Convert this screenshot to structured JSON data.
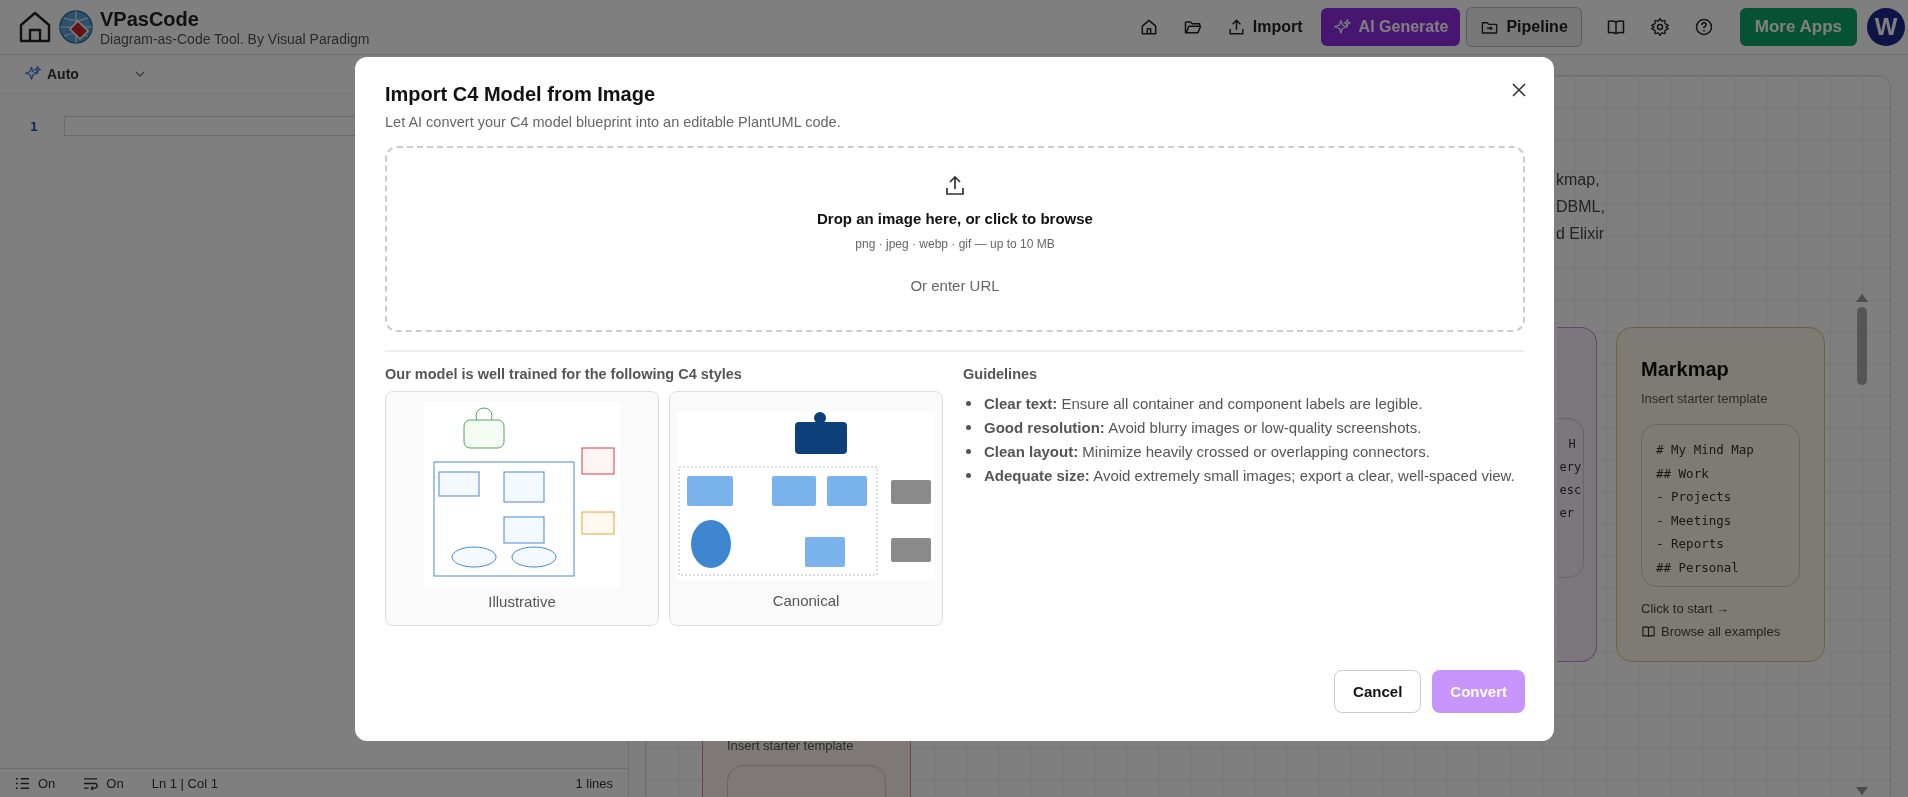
{
  "app": {
    "title": "VPasCode",
    "subtitle": "Diagram-as-Code Tool. By Visual Paradigm"
  },
  "nav": {
    "import": "Import",
    "ai_generate": "AI Generate",
    "pipeline": "Pipeline",
    "more_apps": "More Apps",
    "avatar": "W"
  },
  "editor": {
    "mode": "Auto",
    "line_numbers": [
      "1"
    ],
    "status": {
      "line_numbers": "On",
      "wrap": "On",
      "position": "Ln 1 | Col 1",
      "line_count": "1 lines"
    }
  },
  "canvas": {
    "intro_fragments": [
      "kmap,",
      "DBML,",
      "d Elixir"
    ],
    "cards": [
      {
        "kind": "partial",
        "code": [
          "H",
          "ery",
          "esc",
          "er"
        ]
      },
      {
        "kind": "template",
        "title": "Markmap",
        "subtitle": "Insert starter template",
        "code": [
          "# My Mind Map",
          "## Work",
          "- Projects",
          "- Meetings",
          "- Reports",
          "## Personal"
        ],
        "action": "Click to start →",
        "link": "Browse all examples"
      },
      {
        "kind": "lower",
        "subtitle": "Insert starter template"
      }
    ]
  },
  "modal": {
    "title": "Import C4 Model from Image",
    "subtitle": "Let AI convert your C4 model blueprint into an editable PlantUML code.",
    "dropzone": {
      "heading": "Drop an image here, or click to browse",
      "formats": "png · jpeg · webp · gif — up to 10 MB",
      "url_prompt": "Or enter URL"
    },
    "styles_heading": "Our model is well trained for the following C4 styles",
    "styles": [
      {
        "kind": "illustrative",
        "label": "Illustrative"
      },
      {
        "kind": "canonical",
        "label": "Canonical"
      }
    ],
    "guidelines_heading": "Guidelines",
    "guidelines": [
      "**Clear text:** Ensure all container and component labels are legible.",
      "**Good resolution:** Avoid blurry images or low-quality screenshots.",
      "**Clean layout:** Minimize heavily crossed or overlapping connectors.",
      "**Adequate size:** Avoid extremely small images; export a clear, well-spaced view."
    ],
    "cancel": "Cancel",
    "convert": {
      "label": "Convert",
      "disabled": true
    }
  }
}
